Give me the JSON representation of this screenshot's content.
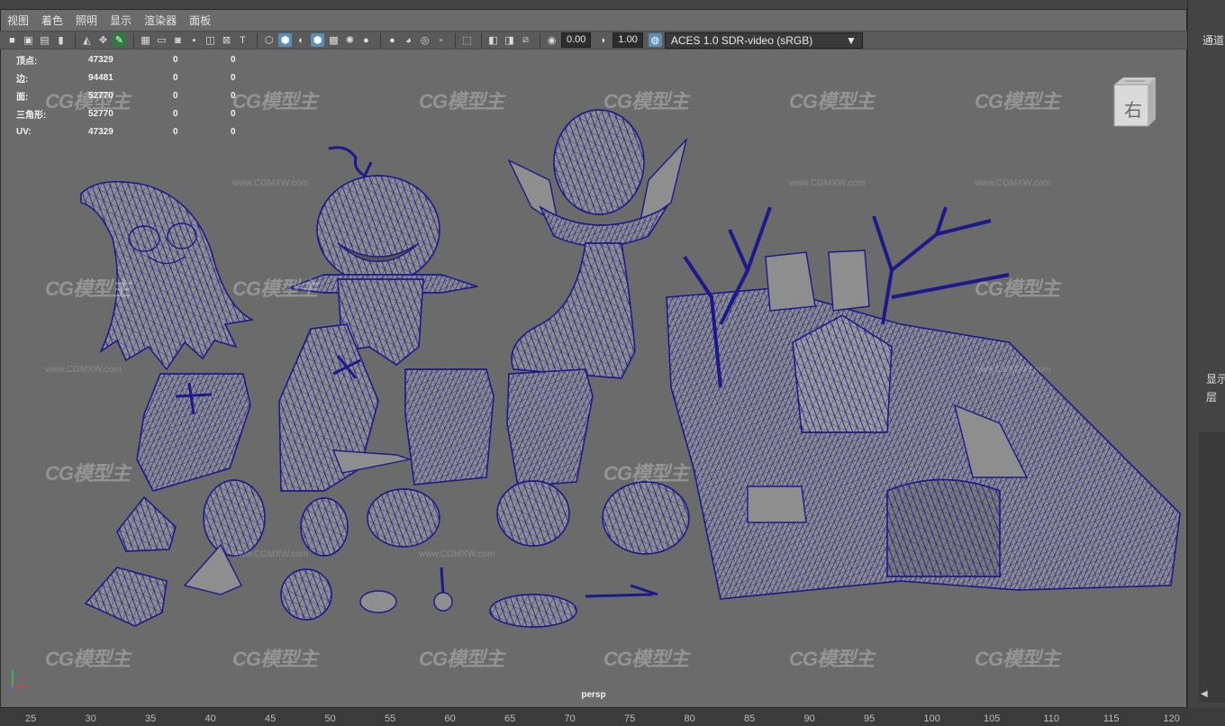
{
  "menubar": {
    "items": [
      "视图",
      "着色",
      "照明",
      "显示",
      "渲染器",
      "面板"
    ]
  },
  "toolbar": {
    "exposure_value": "0.00",
    "gamma_value": "1.00",
    "colorspace_value": "ACES 1.0 SDR-video (sRGB)"
  },
  "stats": [
    {
      "label": "顶点:",
      "value": "47329",
      "c2": "0",
      "c3": "0"
    },
    {
      "label": "边:",
      "value": "94481",
      "c2": "0",
      "c3": "0"
    },
    {
      "label": "面:",
      "value": "52770",
      "c2": "0",
      "c3": "0"
    },
    {
      "label": "三角形:",
      "value": "52770",
      "c2": "0",
      "c3": "0"
    },
    {
      "label": "UV:",
      "value": "47329",
      "c2": "0",
      "c3": "0"
    }
  ],
  "viewcube": {
    "face_label": "右"
  },
  "viewport": {
    "camera_label": "persp"
  },
  "right_panel": {
    "channels_label": "通道",
    "display_label": "显示",
    "layers_label": "层"
  },
  "watermark": {
    "brand": "CG模型主",
    "url": "www.CGMXW.com"
  },
  "ruler_ticks": [
    "25",
    "30",
    "35",
    "40",
    "45",
    "50",
    "55",
    "60",
    "65",
    "70",
    "75",
    "80",
    "85",
    "90",
    "95",
    "100",
    "105",
    "110",
    "115",
    "120"
  ],
  "colors": {
    "wireframe": "#1c1a8a",
    "mesh_fill": "#8e8e8e",
    "viewport_bg": "#6b6b6b"
  }
}
